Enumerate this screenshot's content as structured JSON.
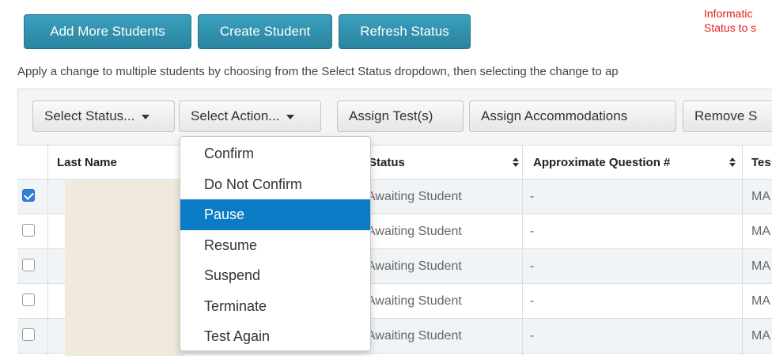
{
  "top_buttons": {
    "add_more_students": "Add More Students",
    "create_student": "Create Student",
    "refresh_status": "Refresh Status"
  },
  "info": {
    "line1": "Informatic",
    "line2": "Status to s"
  },
  "helper_text": "Apply a change to multiple students by choosing from the Select Status dropdown, then selecting the change to ap",
  "toolbar": {
    "select_status": "Select Status...",
    "select_action": "Select Action...",
    "assign_tests": "Assign Test(s)",
    "assign_accommodations": "Assign Accommodations",
    "remove": "Remove S"
  },
  "table": {
    "headers": {
      "last_name": "Last Name",
      "status": "Status",
      "approx_question": "Approximate Question #",
      "test": "Tes"
    },
    "rows": [
      {
        "checked": true,
        "status": "Awaiting Student",
        "question": "-",
        "test": "MA"
      },
      {
        "checked": false,
        "status": "Awaiting Student",
        "question": "-",
        "test": "MA"
      },
      {
        "checked": false,
        "status": "Awaiting Student",
        "question": "-",
        "test": "MA"
      },
      {
        "checked": false,
        "status": "Awaiting Student",
        "question": "-",
        "test": "MA"
      },
      {
        "checked": false,
        "status": "Awaiting Student",
        "question": "-",
        "test": "MA"
      }
    ]
  },
  "action_menu": {
    "items": [
      "Confirm",
      "Do Not Confirm",
      "Pause",
      "Resume",
      "Suspend",
      "Terminate",
      "Test Again"
    ],
    "highlighted": "Pause"
  },
  "colors": {
    "primary_button": "#2f8fab",
    "highlight": "#0a7bc4",
    "info_text": "#e02020",
    "checkbox_checked": "#2f7fd8"
  }
}
